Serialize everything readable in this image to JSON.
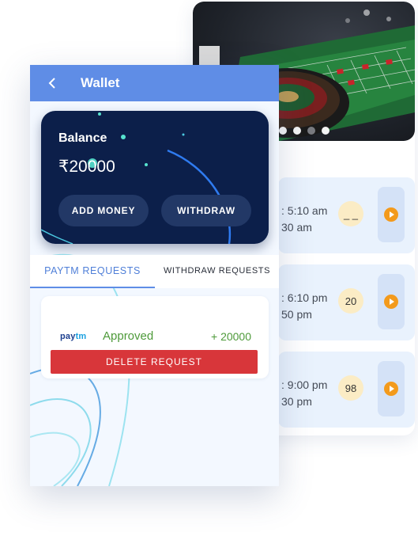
{
  "banner": {
    "indicator_count": 5,
    "active_indicator": 4
  },
  "game_list": [
    {
      "time_start": ": 5:10 am",
      "time_end": "30 am",
      "result": "_ _"
    },
    {
      "time_start": ": 6:10 pm",
      "time_end": "50 pm",
      "result": "20"
    },
    {
      "time_start": ": 9:00 pm",
      "time_end": "30 pm",
      "result": "98"
    }
  ],
  "wallet": {
    "title": "Wallet",
    "balance_label": "Balance",
    "balance_amount": "₹20000",
    "add_money_label": "ADD MONEY",
    "withdraw_label": "WITHDRAW"
  },
  "tabs": {
    "paytm": "PAYTM REQUESTS",
    "withdraw": "WITHDRAW REQUESTS",
    "active": "paytm"
  },
  "request": {
    "logo_text_a": "pay",
    "logo_text_b": "tm",
    "status": "Approved",
    "amount": "+ 20000",
    "delete_label": "DELETE REQUEST"
  },
  "colors": {
    "appbar": "#5f8de6",
    "card": "#0c1f4a",
    "approved": "#4e9a3a",
    "delete": "#d8363a",
    "play": "#f39a1c"
  }
}
